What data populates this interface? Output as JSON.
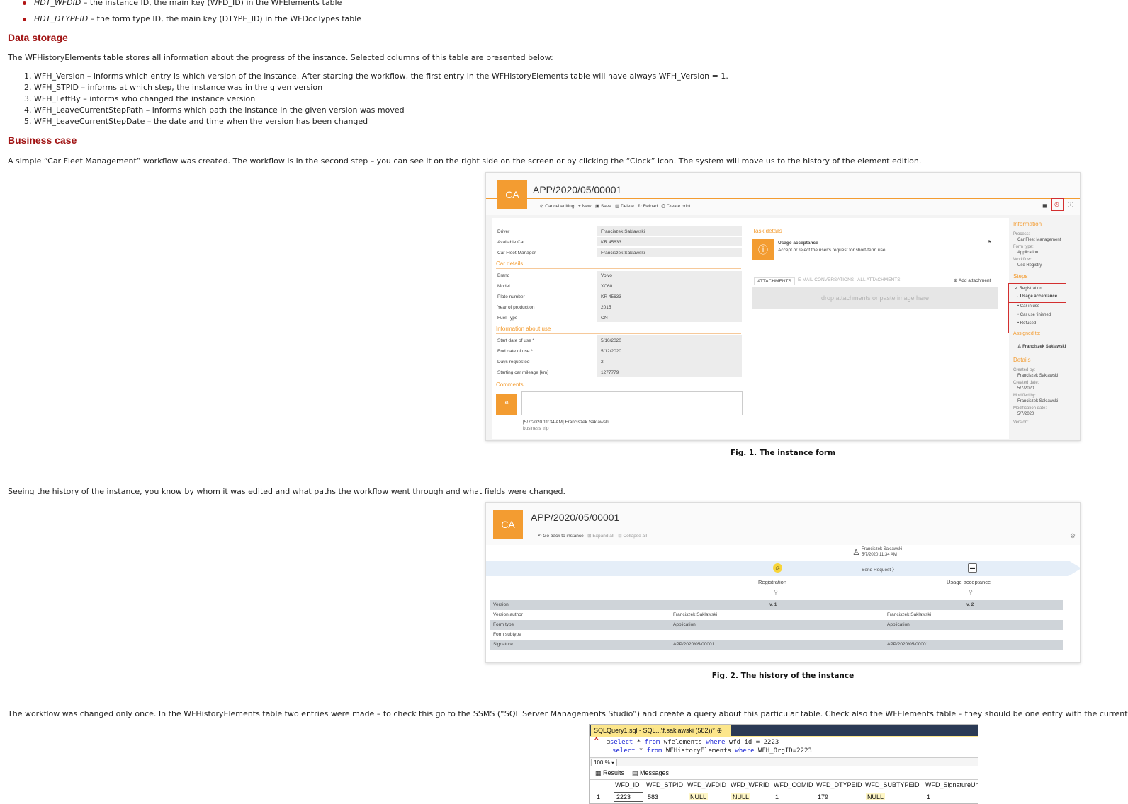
{
  "intro_bullets": [
    {
      "code": "HDT_WFDID",
      "text": " – the instance ID, the main key (WFD_ID) in the WFElements table"
    },
    {
      "code": "HDT_DTYPEID",
      "text": " – the form type ID, the main key (DTYPE_ID) in the WFDocTypes table"
    }
  ],
  "data_storage": {
    "heading": "Data storage",
    "intro": "The WFHistoryElements table stores all information about the progress of the instance. Selected columns of this table are presented below:",
    "items": [
      "1. WFH_Version – informs which entry is which version of the instance. After starting the workflow, the first entry in the WFHistoryElements table will have always WFH_Version = 1.",
      "2. WFH_STPID – informs at which step, the instance was in the given version",
      "3. WFH_LeftBy – informs who changed the instance version",
      "4. WFH_LeaveCurrentStepPath – informs which path the instance in the given version was moved",
      "5. WFH_LeaveCurrentStepDate – the date and time when the version has been changed"
    ]
  },
  "business_case": {
    "heading": "Business case",
    "para1": "A simple “Car Fleet Management” workflow was created. The workflow is in the second step – you can see it on the right side on the screen or by clicking the “Clock” icon. The system will move us to the history of the element edition.",
    "para2": "Seeing the history of the instance, you know by whom it was edited and what paths the workflow went through and what fields were changed.",
    "para3": "The workflow was changed only once. In the WFHistoryElements table two entries were made – to check this go to the SSMS (“SQL Server Managements Studio”) and create a query about this particular table. Check also the WFElements table – they should be one entry with the current data."
  },
  "figure1": {
    "caption": "Fig. 1. The instance form",
    "badge": "CA",
    "title": "APP/2020/05/00001",
    "toolbar": [
      "Cancel editing",
      "New",
      "Save",
      "Delete",
      "Reload",
      "Create print"
    ],
    "fields_top": [
      {
        "label": "Driver",
        "value": "Franciszek Saklawski"
      },
      {
        "label": "Available Car",
        "value": "KR 45633"
      },
      {
        "label": "Car Fleet Manager",
        "value": "Franciszek Saklawski"
      }
    ],
    "car_details_title": "Car details",
    "car_details": [
      {
        "label": "Brand",
        "value": "Volvo"
      },
      {
        "label": "Model",
        "value": "XC60"
      },
      {
        "label": "Plate number",
        "value": "KR 45633"
      },
      {
        "label": "Year of production",
        "value": "2015"
      },
      {
        "label": "Fuel Type",
        "value": "ON"
      }
    ],
    "info_use_title": "Information about use",
    "info_use": [
      {
        "label": "Start date of use *",
        "value": "5/10/2020"
      },
      {
        "label": "End date of use *",
        "value": "5/12/2020"
      },
      {
        "label": "Days requested",
        "value": "2"
      },
      {
        "label": "Starting car mileage [km]",
        "value": "1277779"
      }
    ],
    "comments_title": "Comments",
    "comment_meta": "[5/7/2020 11:34 AM] Franciszek Saklawski",
    "comment_text": "business trip",
    "task_title": "Task details",
    "task_name": "Usage acceptance",
    "task_desc": "Accept or reject the user's request for short-term use",
    "tabs": [
      "ATTACHMENTS",
      "E-MAIL CONVERSATIONS",
      "ALL ATTACHMENTS"
    ],
    "add_attachment": "Add attachment",
    "drop_text": "drop attachments or paste image here",
    "side": {
      "info_title": "Information",
      "process_label": "Process:",
      "process": "Car Fleet Management",
      "form_type_label": "Form type:",
      "form_type": "Application",
      "workflow_label": "Workflow:",
      "workflow": "Use Registry",
      "steps_title": "Steps",
      "steps": [
        "Registration",
        "Usage acceptance",
        "Car in use",
        "Car use finished",
        "Refused"
      ],
      "assigned_title": "Assigned to:",
      "assigned": "Franciszek Saklawski",
      "details_title": "Details",
      "created_by_label": "Created by:",
      "created_by": "Franciszek Saklawski",
      "created_date_label": "Created date:",
      "created_date": "5/7/2020",
      "modified_by_label": "Modified by:",
      "modified_by": "Franciszek Saklawski",
      "modified_date_label": "Modification date:",
      "modified_date": "5/7/2020",
      "version_label": "Version:"
    }
  },
  "figure2": {
    "caption": "Fig. 2. The history of the instance",
    "badge": "CA",
    "title": "APP/2020/05/00001",
    "toolbar": [
      "Go back to instance",
      "Expand all",
      "Collapse all"
    ],
    "author": "Franciszek Saklawski",
    "author_date": "5/7/2020 11:34 AM",
    "path": "Send Request",
    "step1": "Registration",
    "step2": "Usage acceptance",
    "rows": [
      {
        "label": "Version",
        "v1": "v. 1",
        "v2": "v. 2"
      },
      {
        "label": "Version author",
        "v1": "Franciszek Saklawski",
        "v2": "Franciszek Saklawski"
      },
      {
        "label": "Form type",
        "v1": "Application",
        "v2": "Application"
      },
      {
        "label": "Form subtype",
        "v1": "",
        "v2": ""
      },
      {
        "label": "Signature",
        "v1": "APP/2020/05/00001",
        "v2": "APP/2020/05/00001"
      }
    ]
  },
  "figure3": {
    "tab_title": "SQLQuery1.sql - SQL...\\f.saklawski (582))*",
    "line1": {
      "kw1": "select",
      "mid1": " * ",
      "kw2": "from",
      "mid2": " wfelements ",
      "kw3": "where",
      "rest": " wfd_id = 2223"
    },
    "line2": {
      "kw1": "select",
      "mid1": " * ",
      "kw2": "from",
      "mid2": " WFHistoryElements ",
      "kw3": "where",
      "rest": " WFH_OrgID=2223"
    },
    "zoom": "100 %",
    "results_tab": "Results",
    "messages_tab": "Messages",
    "columns": [
      "WFD_ID",
      "WFD_STPID",
      "WFD_WFDID",
      "WFD_WFRID",
      "WFD_COMID",
      "WFD_DTYPEID",
      "WFD_SUBTYPEID",
      "WFD_SignatureUni"
    ],
    "row1": [
      "1",
      "2223",
      "583",
      "NULL",
      "NULL",
      "1",
      "179",
      "NULL",
      "1"
    ]
  }
}
